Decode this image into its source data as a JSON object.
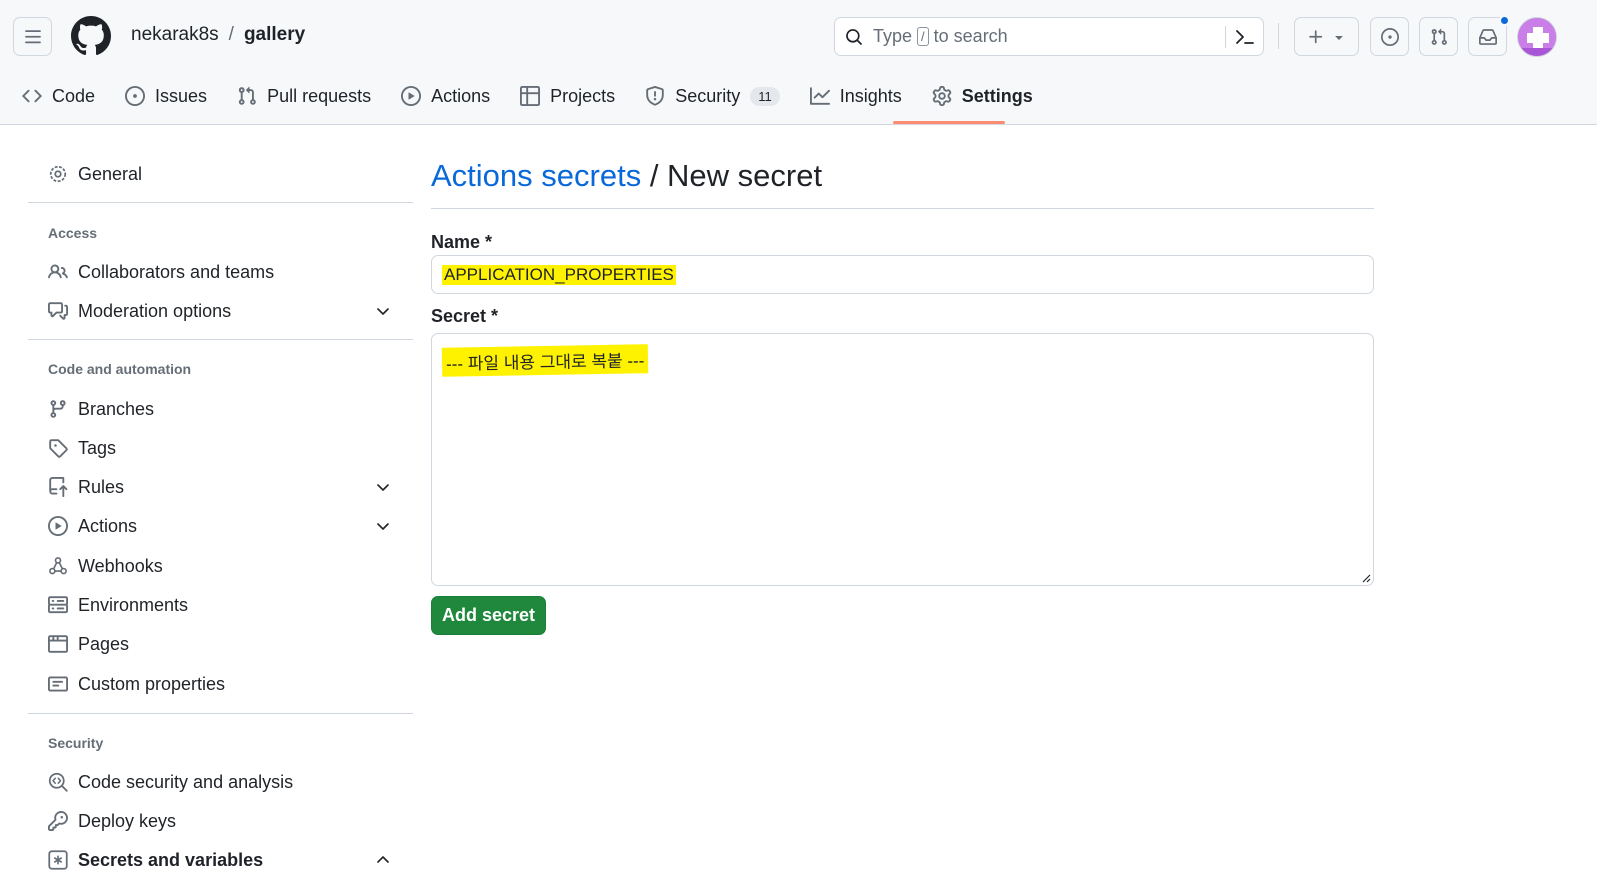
{
  "header": {
    "owner": "nekarak8s",
    "separator": "/",
    "repo": "gallery",
    "search_prefix": "Type",
    "search_key": "/",
    "search_suffix": "to search"
  },
  "tabs": [
    {
      "label": "Code",
      "icon": "code-icon"
    },
    {
      "label": "Issues",
      "icon": "issue-icon"
    },
    {
      "label": "Pull requests",
      "icon": "pull-request-icon"
    },
    {
      "label": "Actions",
      "icon": "play-icon"
    },
    {
      "label": "Projects",
      "icon": "table-icon"
    },
    {
      "label": "Security",
      "icon": "shield-icon",
      "counter": "11"
    },
    {
      "label": "Insights",
      "icon": "graph-icon"
    },
    {
      "label": "Settings",
      "icon": "gear-icon",
      "active": true
    }
  ],
  "sidebar": {
    "general": "General",
    "access_heading": "Access",
    "access_items": [
      "Collaborators and teams",
      "Moderation options"
    ],
    "code_heading": "Code and automation",
    "code_items": [
      "Branches",
      "Tags",
      "Rules",
      "Actions",
      "Webhooks",
      "Environments",
      "Pages",
      "Custom properties"
    ],
    "security_heading": "Security",
    "security_items": [
      "Code security and analysis",
      "Deploy keys",
      "Secrets and variables"
    ]
  },
  "main": {
    "breadcrumb_link": "Actions secrets",
    "breadcrumb_sep": " / ",
    "title": "New secret",
    "name_label": "Name *",
    "name_value": "APPLICATION_PROPERTIES",
    "secret_label": "Secret *",
    "secret_value": "--- 파일 내용 그대로 복붙 ---",
    "add_button": "Add secret"
  },
  "colors": {
    "accent_link": "#0969da",
    "primary_button": "#1f883d",
    "tab_underline": "#fd8c73",
    "highlight": "#fff200"
  }
}
